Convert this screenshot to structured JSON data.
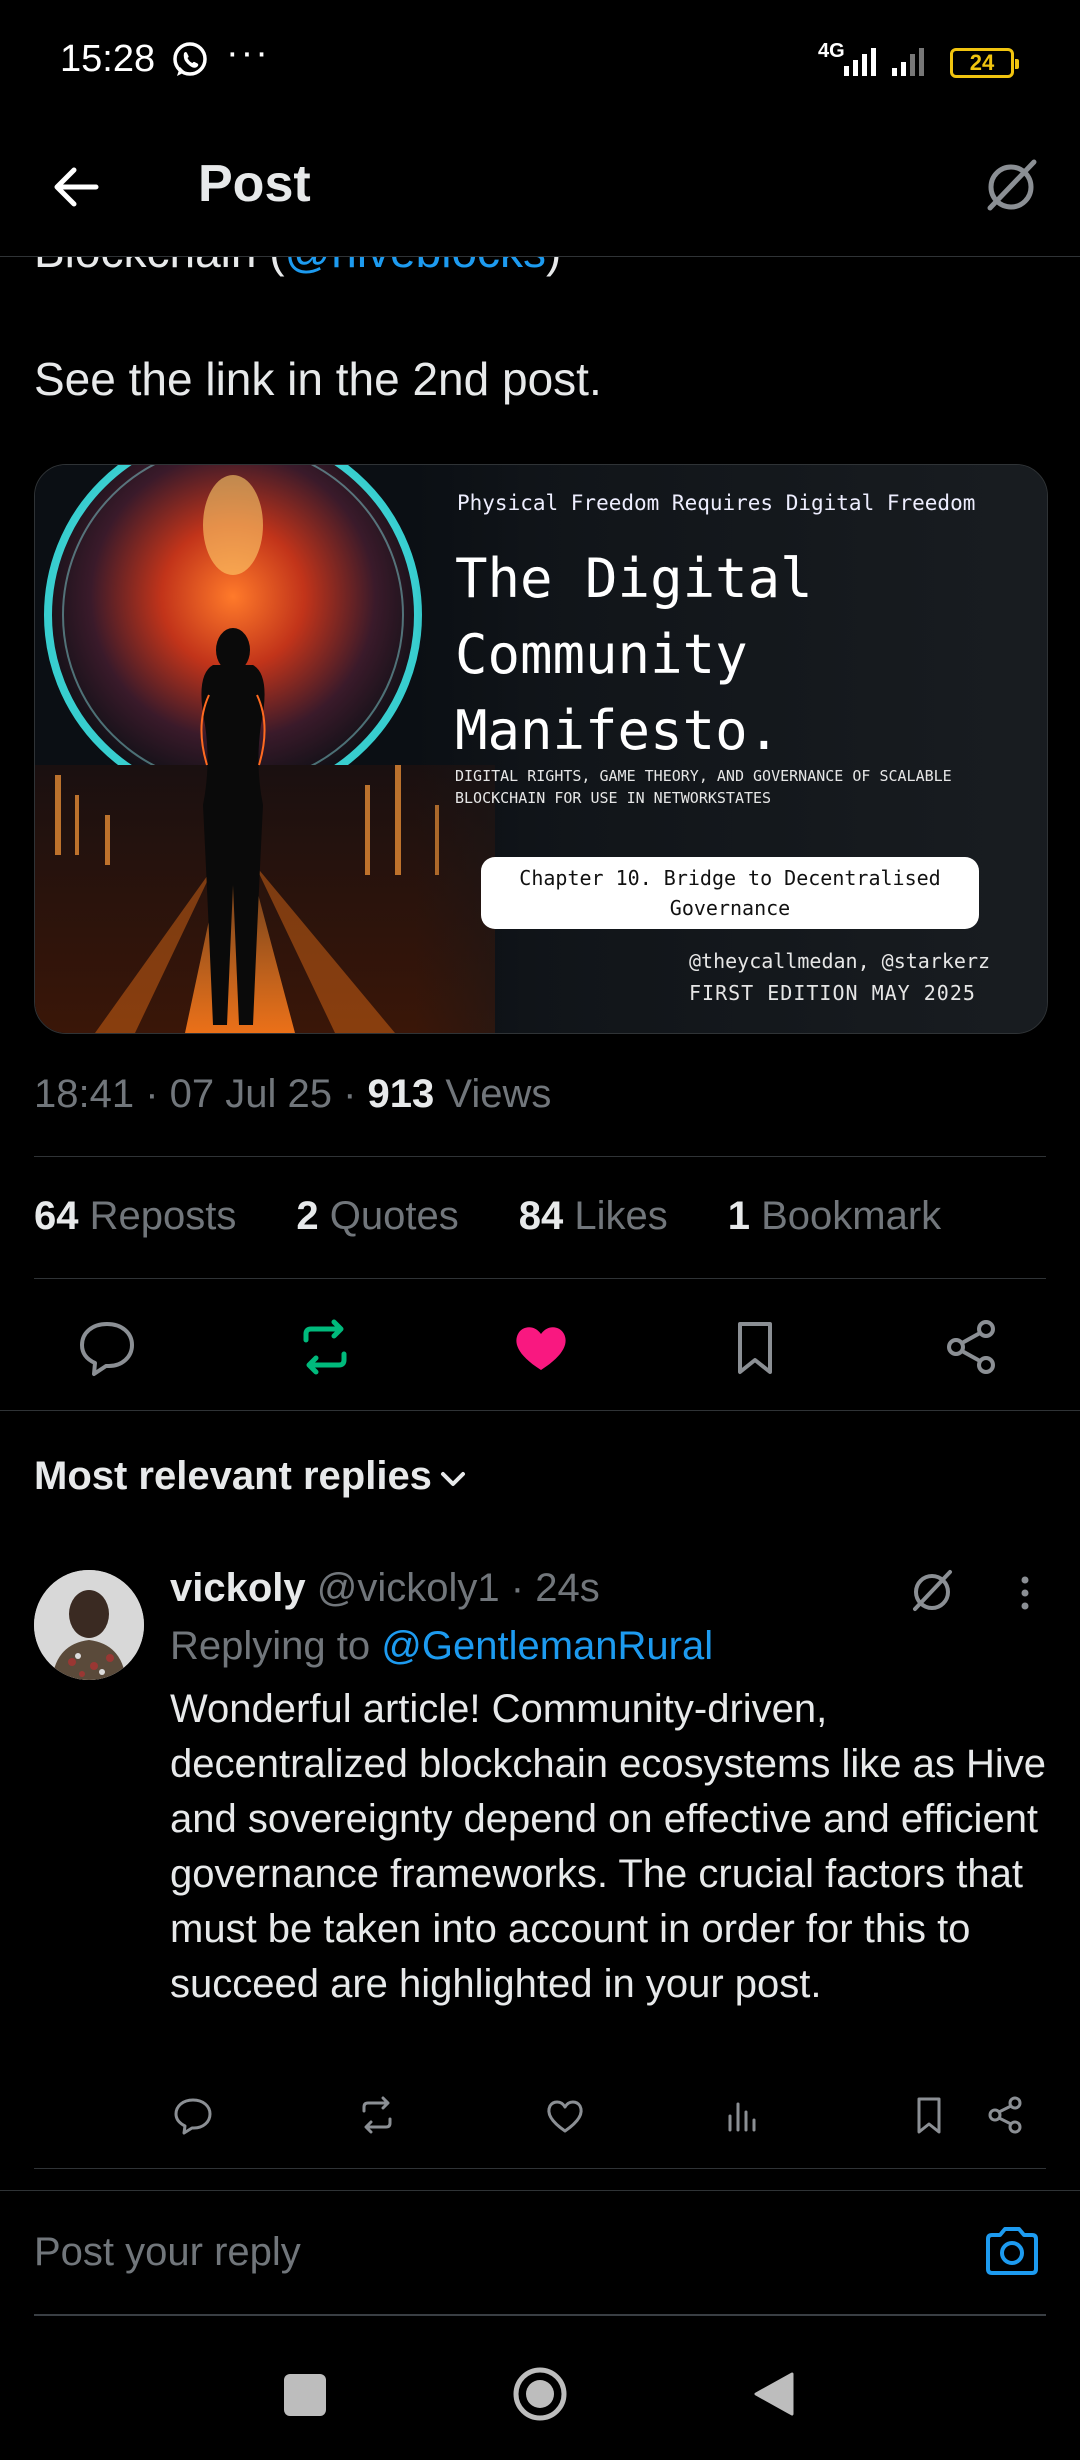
{
  "status_bar": {
    "time": "15:28",
    "more": "···",
    "network": "4G",
    "battery": "24",
    "battery_color": "#f1c40f"
  },
  "header": {
    "title": "Post",
    "back_icon": "arrow-left-icon",
    "grok_icon": "grok-icon"
  },
  "post": {
    "partial_line_text": "Blockchain (",
    "partial_line_link": "@hiveblocks",
    "partial_line_end": ")",
    "text": "See the link in the 2nd post.",
    "media": {
      "tagline": "Physical Freedom Requires Digital Freedom",
      "title_line1": "The Digital",
      "title_line2": "Community",
      "title_line3": "Manifesto.",
      "subtitle_line1": "DIGITAL RIGHTS, GAME THEORY, AND GOVERNANCE OF SCALABLE",
      "subtitle_line2": "BLOCKCHAIN FOR USE IN NETWORKSTATES",
      "chapter_line1": "Chapter 10. Bridge to Decentralised",
      "chapter_line2": "Governance",
      "authors": "@theycallmedan, @starkerz",
      "edition": "FIRST EDITION MAY 2025"
    },
    "time": "18:41",
    "date": "07 Jul 25",
    "views_count": "913",
    "views_label": "Views",
    "stats": {
      "reposts_count": "64",
      "reposts_label": "Reposts",
      "quotes_count": "2",
      "quotes_label": "Quotes",
      "likes_count": "84",
      "likes_label": "Likes",
      "bookmarks_count": "1",
      "bookmarks_label": "Bookmark"
    },
    "actions": {
      "reply_icon": "reply-icon",
      "repost_icon": "repost-icon",
      "like_icon": "heart-icon",
      "bookmark_icon": "bookmark-icon",
      "share_icon": "share-icon",
      "repost_color": "#00ba7c",
      "like_color": "#f91880"
    }
  },
  "replies": {
    "sort_label": "Most relevant replies",
    "items": [
      {
        "name": "vickoly",
        "handle": "@vickoly1",
        "time": "24s",
        "replying_label": "Replying to",
        "replying_to": "@GentlemanRural",
        "body": "Wonderful article!  Community-driven, decentralized blockchain ecosystems like as Hive and sovereignty depend on effective and efficient governance frameworks.  The crucial factors that must be taken into account in order for this to succeed are highlighted in your post."
      }
    ]
  },
  "composer": {
    "placeholder": "Post your reply",
    "camera_icon": "camera-icon"
  },
  "colors": {
    "accent": "#1d9bf0",
    "muted": "#71767b",
    "text": "#e7e9ea",
    "divider": "#2f3336"
  }
}
